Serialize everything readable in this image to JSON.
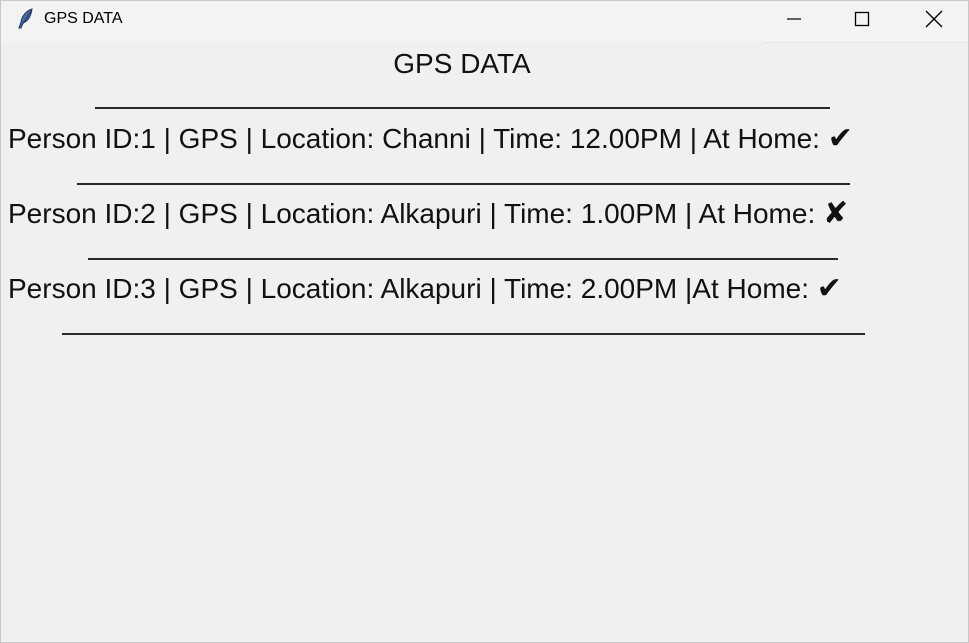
{
  "window": {
    "title": "GPS DATA"
  },
  "main": {
    "heading": "GPS DATA",
    "rows": [
      {
        "text": "Person ID:1 | GPS | Location: Channi | Time: 12.00PM | At Home: ",
        "mark": "✔"
      },
      {
        "text": "Person ID:2 | GPS | Location: Alkapuri | Time: 1.00PM | At Home:  ",
        "mark": "✘"
      },
      {
        "text": "Person ID:3 | GPS | Location: Alkapuri | Time: 2.00PM |At Home: ",
        "mark": "✔"
      }
    ]
  },
  "icons": {
    "app": "feather-icon",
    "minimize": "minimize-icon",
    "maximize": "maximize-icon",
    "close": "close-icon"
  }
}
